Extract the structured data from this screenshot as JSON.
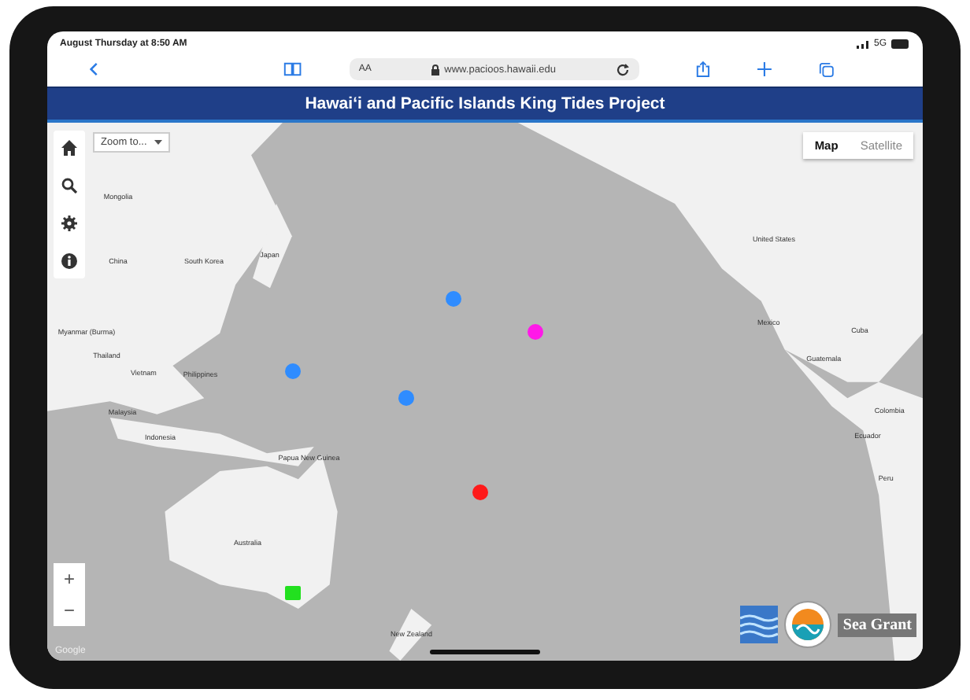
{
  "status_bar": {
    "time": "August Thursday at 8:50 AM",
    "network": "5G"
  },
  "browser": {
    "text_size": "AA",
    "url": "www.pacioos.hawaii.edu"
  },
  "banner": {
    "title": "Hawaiʻi and Pacific Islands King Tides Project"
  },
  "map": {
    "zoom_select": {
      "value": "Zoom to..."
    },
    "map_types": [
      {
        "label": "Map",
        "selected": true
      },
      {
        "label": "Satellite",
        "selected": false
      }
    ],
    "zoom_buttons": [
      "+",
      "−"
    ],
    "labels": [
      "Mongolia",
      "China",
      "South Korea",
      "Japan",
      "Myanmar (Burma)",
      "Thailand",
      "Vietnam",
      "Philippines",
      "Malaysia",
      "Indonesia",
      "Papua New Guinea",
      "Australia",
      "New Zealand",
      "United States",
      "Mexico",
      "Cuba",
      "Guatemala",
      "Colombia",
      "Ecuador",
      "Peru"
    ],
    "markers": [
      {
        "kind": "circle",
        "color": "#2f8cff"
      },
      {
        "kind": "circle",
        "color": "#2f8cff"
      },
      {
        "kind": "circle",
        "color": "#2f8cff"
      },
      {
        "kind": "circle",
        "color": "#ff19e8"
      },
      {
        "kind": "circle",
        "color": "#ff1a1a"
      },
      {
        "kind": "square",
        "color": "#22e01f"
      }
    ],
    "attribution": "Google",
    "logo_text": "Sea Grant"
  }
}
